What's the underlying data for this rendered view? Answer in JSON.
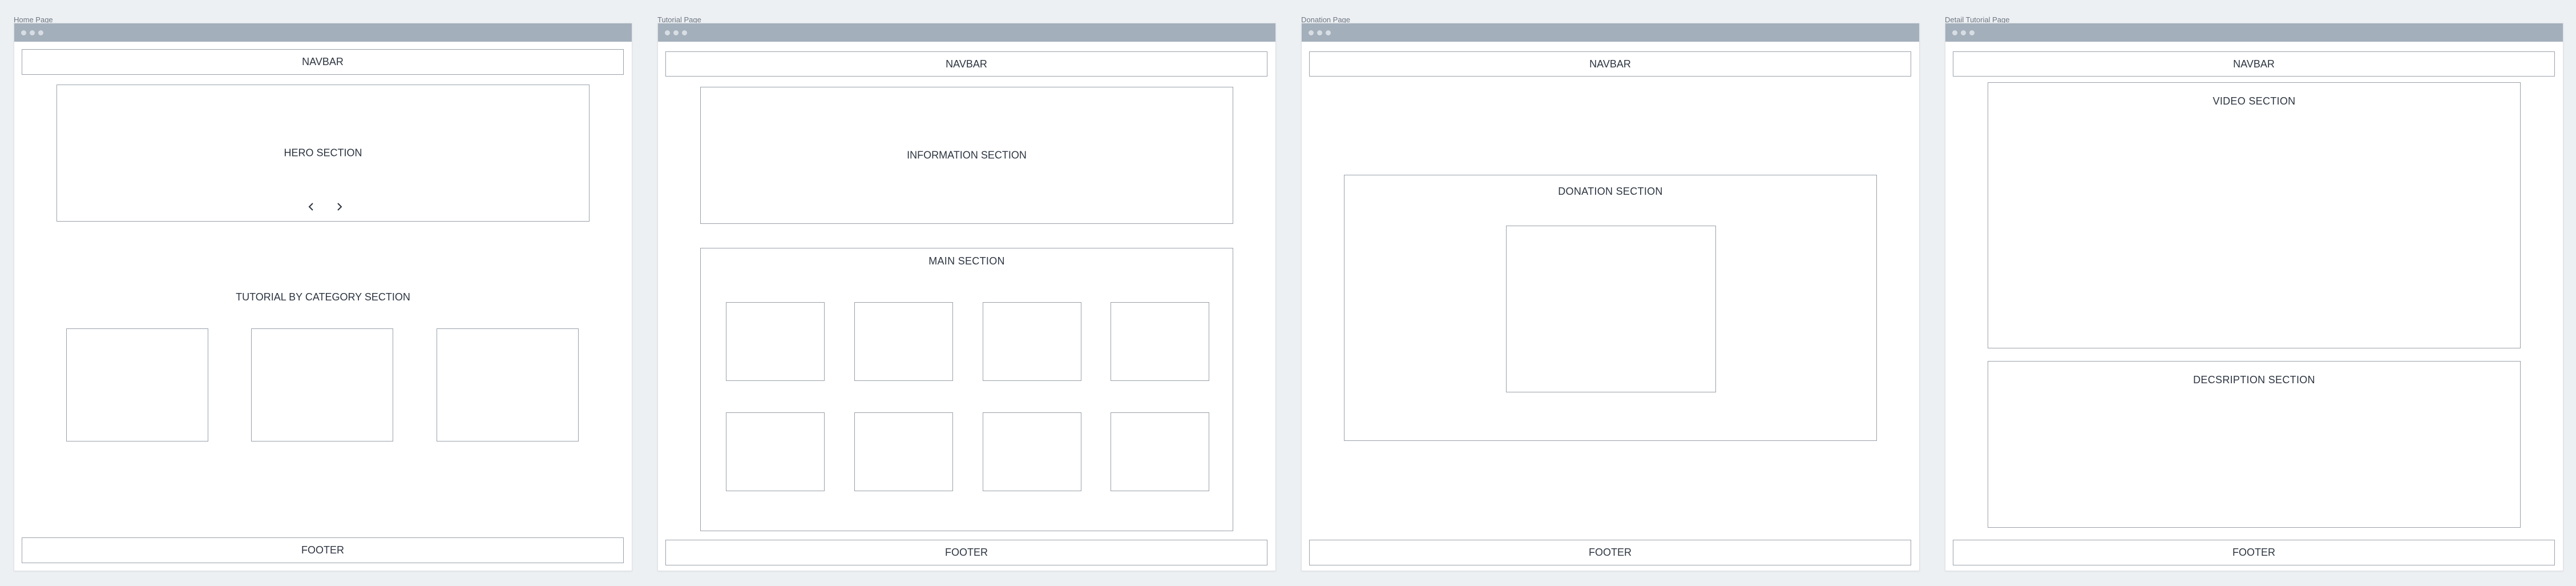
{
  "frames": [
    {
      "label": "Home Page",
      "navbar": "NAVBAR",
      "hero": "HERO SECTION",
      "category_title": "TUTORIAL BY CATEGORY SECTION",
      "footer": "FOOTER",
      "icons": [
        "chevron-left-icon",
        "chevron-right-icon"
      ]
    },
    {
      "label": "Tutorial Page",
      "navbar": "NAVBAR",
      "info": "INFORMATION SECTION",
      "main": "MAIN SECTION",
      "footer": "FOOTER"
    },
    {
      "label": "Donation Page",
      "navbar": "NAVBAR",
      "donation": "DONATION SECTION",
      "footer": "FOOTER"
    },
    {
      "label": "Detail Tutorial Page",
      "navbar": "NAVBAR",
      "video": "VIDEO SECTION",
      "description": "DECSRIPTION SECTION",
      "footer": "FOOTER"
    }
  ],
  "colors": {
    "titlebar": "#a3afbb",
    "border": "#9aa1aa",
    "background": "#edf0f3"
  }
}
